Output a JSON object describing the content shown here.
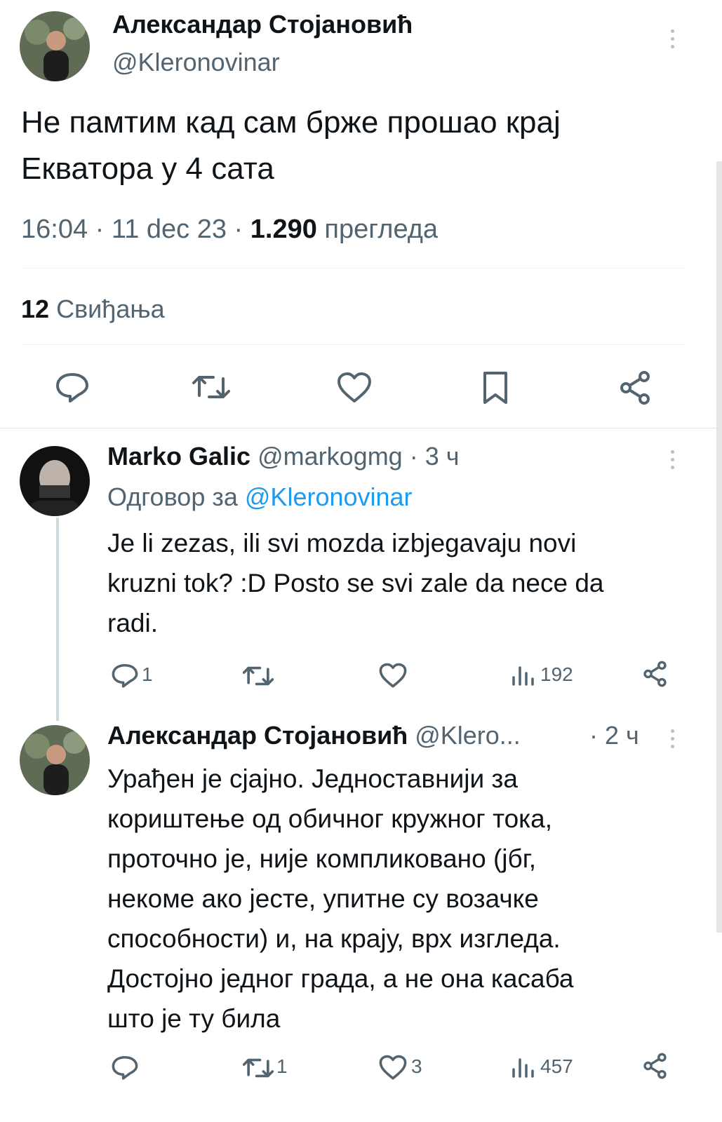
{
  "main_tweet": {
    "author_name": "Александар Стојановић",
    "author_handle": "@Kleronovinar",
    "text_line1": "Не памтим кад сам брже прошао крај",
    "text_line2": "Екватора у 4 сата",
    "time": "16:04",
    "date": "11 dec 23",
    "views_count": "1.290",
    "views_label": "прегледа",
    "likes_count": "12",
    "likes_label": "Свиђања"
  },
  "reply1": {
    "author_name": "Marko Galic",
    "author_handle": "@markogmg",
    "time": "3 ч",
    "reply_to_label": "Одговор за",
    "reply_to_handle": "@Kleronovinar",
    "text_line1": "Je li zezas, ili svi mozda izbjegavaju novi",
    "text_line2": "kruzni tok? :D Posto se svi zale da nece da",
    "text_line3": "radi.",
    "reply_count": "1",
    "views": "192"
  },
  "reply2": {
    "author_name": "Александар Стојановић",
    "author_handle": "@Klero...",
    "time": "2 ч",
    "text_lines": [
      "Урађен је сјајно. Једноставнији за",
      "кориштење од обичног кружног тока,",
      "проточно је, није компликовано (јбг,",
      "некоме ако јесте, упитне су возачке",
      "способности) и, на крају, врх изгледа.",
      "Достојно једног града, а не она касаба",
      "што је ту била"
    ],
    "retweet_count": "1",
    "like_count": "3",
    "views": "457"
  },
  "icons": {
    "reply": "reply-icon",
    "retweet": "retweet-icon",
    "like": "heart-icon",
    "bookmark": "bookmark-icon",
    "share": "share-icon",
    "views": "views-icon",
    "more": "more-icon"
  },
  "colors": {
    "link": "#1d9bf0",
    "muted": "#536471",
    "text": "#0f1419"
  }
}
